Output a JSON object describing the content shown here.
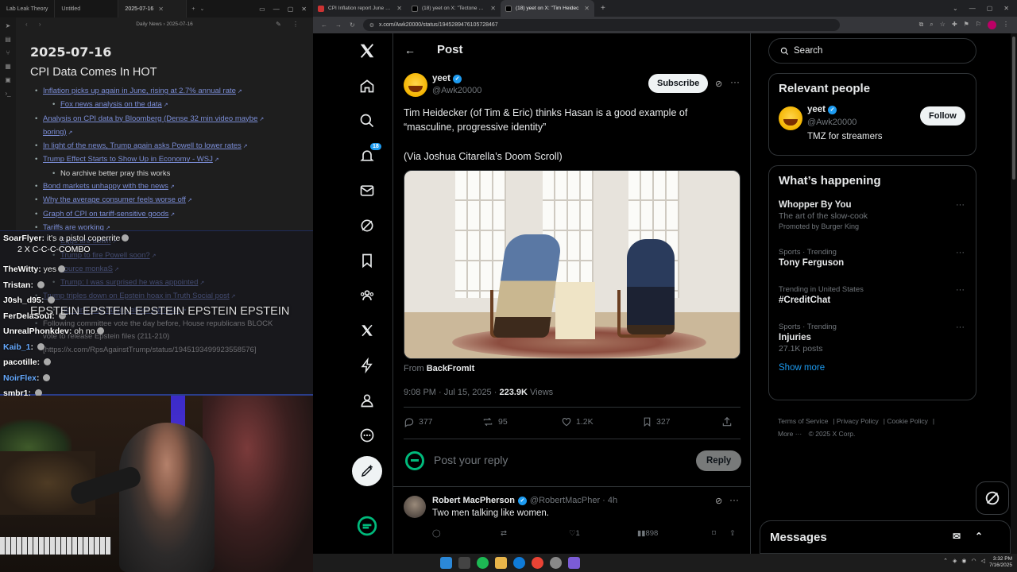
{
  "left_app": {
    "tabs": [
      {
        "label": "Lab Leak Theory"
      },
      {
        "label": "Untitled"
      },
      {
        "label": "2025-07-16",
        "active": true
      }
    ],
    "breadcrumb": "Daily News  ›  2025-07-16",
    "note": {
      "date_heading": "2025-07-16",
      "section_heading": "CPI Data Comes In HOT",
      "items": [
        {
          "text": "Inflation picks up again in June, rising at 2.7% annual rate",
          "link": true,
          "level": 1
        },
        {
          "text": "Fox news analysis on the data",
          "link": true,
          "level": 2
        },
        {
          "text": "Analysis on CPI data by Bloomberg (Dense 32 min video maybe",
          "link": true,
          "level": 1
        },
        {
          "text": "boring)",
          "link": true,
          "level": 0
        },
        {
          "text": "In light of the news, Trump again asks Powell to lower rates",
          "link": true,
          "level": 1
        },
        {
          "text": "Trump Effect Starts to Show Up in Economy - WSJ",
          "link": true,
          "level": 1
        },
        {
          "text": "No archive better pray this works",
          "link": false,
          "level": 2
        },
        {
          "text": "Bond markets unhappy with the news",
          "link": true,
          "level": 1
        },
        {
          "text": "Why the average consumer feels worse off",
          "link": true,
          "level": 1
        },
        {
          "text": "Graph of CPI on tariff-sensitive goods",
          "link": true,
          "level": 1
        },
        {
          "text": "Tariffs are working",
          "link": true,
          "level": 1
        },
        {
          "text": "Eggs are down",
          "link": true,
          "level": 2
        },
        {
          "text": "Trump to fire Powell soon?",
          "link": true,
          "level": 2
        },
        {
          "text": "source monkaS",
          "link": true,
          "level": 2
        },
        {
          "text": "Trump: I was surprised he was appointed",
          "link": true,
          "level": 2
        },
        {
          "text": "",
          "link": false,
          "level": 0
        },
        {
          "text": "Trump triples down on Epstein hoax in Truth Social post",
          "link": true,
          "level": 1
        },
        {
          "text": "He can't stop talking about the hoax",
          "link": true,
          "level": 2
        },
        {
          "text": "Following committee vote the day before, House republicans BLOCK",
          "link": false,
          "level": 1
        },
        {
          "text": "vote to release Epstein files (211-210)",
          "link": false,
          "level": 0
        },
        {
          "text": "[https://x.com/RpsAgainstTrump/status/1945193499923558576]",
          "link": false,
          "level": 0
        }
      ]
    },
    "chat": {
      "lines": [
        {
          "user": "SoarFlyer",
          "msg": "it's a pistol coperrite"
        },
        {
          "user": "",
          "msg": ""
        },
        {
          "user": "TheWitty",
          "msg": "yes"
        },
        {
          "user": "Tristan",
          "msg": ""
        },
        {
          "user": "J0sh_d95",
          "msg": ""
        },
        {
          "user": "FerDelaSoul",
          "msg": ""
        },
        {
          "user": "UnrealPhonkdev",
          "msg": "oh no"
        },
        {
          "user": "Kaib_1",
          "msg": ""
        },
        {
          "user": "pacotille",
          "msg": ""
        },
        {
          "user": "NoirFlex",
          "msg": ""
        },
        {
          "user": "smbr1",
          "msg": ""
        }
      ],
      "combo": "2 X C-C-C-COMBO",
      "big_message": "EPSTEIN EPSTEIN EPSTEIN EPSTEIN EPSTEIN"
    }
  },
  "browser": {
    "tabs": [
      {
        "label": "CPI Inflation report June 2025:",
        "active": false
      },
      {
        "label": "(18) yeet on X: \"Tectone and th",
        "active": false
      },
      {
        "label": "(18) yeet on X: \"Tim Heidec",
        "active": true
      }
    ],
    "url": "x.com/Awk20000/status/1945289476105728467",
    "notification_count": "18"
  },
  "post": {
    "header_title": "Post",
    "author_name": "yeet",
    "author_handle": "@Awk20000",
    "subscribe_label": "Subscribe",
    "text_line1": "Tim Heidecker (of Tim & Eric) thinks Hasan is a good example of “masculine, progressive identity”",
    "text_line2": "(Via Joshua Citarella’s Doom Scroll)",
    "from_prefix": "From",
    "from_source": "BackFromIt",
    "time": "9:08 PM · Jul 15, 2025 · ",
    "views_count": "223.9K",
    "views_label": " Views",
    "replies": "377",
    "reposts": "95",
    "likes": "1.2K",
    "bookmarks": "327",
    "reply_placeholder": "Post your reply",
    "reply_button": "Reply"
  },
  "reply": {
    "name": "Robert MacPherson",
    "handle": "@RobertMacPher · 4h",
    "text": "Two men talking like women.",
    "likes": "1",
    "views": "898"
  },
  "sidebar": {
    "search_placeholder": "Search",
    "relevant_title": "Relevant people",
    "person": {
      "name": "yeet",
      "handle": "@Awk20000",
      "bio": "TMZ for streamers",
      "follow_label": "Follow"
    },
    "happening_title": "What’s happening",
    "trends": [
      {
        "context": "",
        "title": "Whopper By You",
        "sub": "The art of the slow-cook",
        "promo": "Promoted by Burger King"
      },
      {
        "context": "Sports · Trending",
        "title": "Tony Ferguson",
        "sub": "",
        "promo": ""
      },
      {
        "context": "Trending in United States",
        "title": "#CreditChat",
        "sub": "",
        "promo": ""
      },
      {
        "context": "Sports · Trending",
        "title": "Injuries",
        "sub": "27.1K posts",
        "promo": ""
      }
    ],
    "show_more": "Show more",
    "footer": {
      "terms": "Terms of Service",
      "privacy": "Privacy Policy",
      "cookie": "Cookie Policy",
      "more": "More ···",
      "copyright": "© 2025 X Corp."
    }
  },
  "messages_label": "Messages",
  "clock": {
    "time": "3:32 PM",
    "date": "7/16/2025"
  }
}
